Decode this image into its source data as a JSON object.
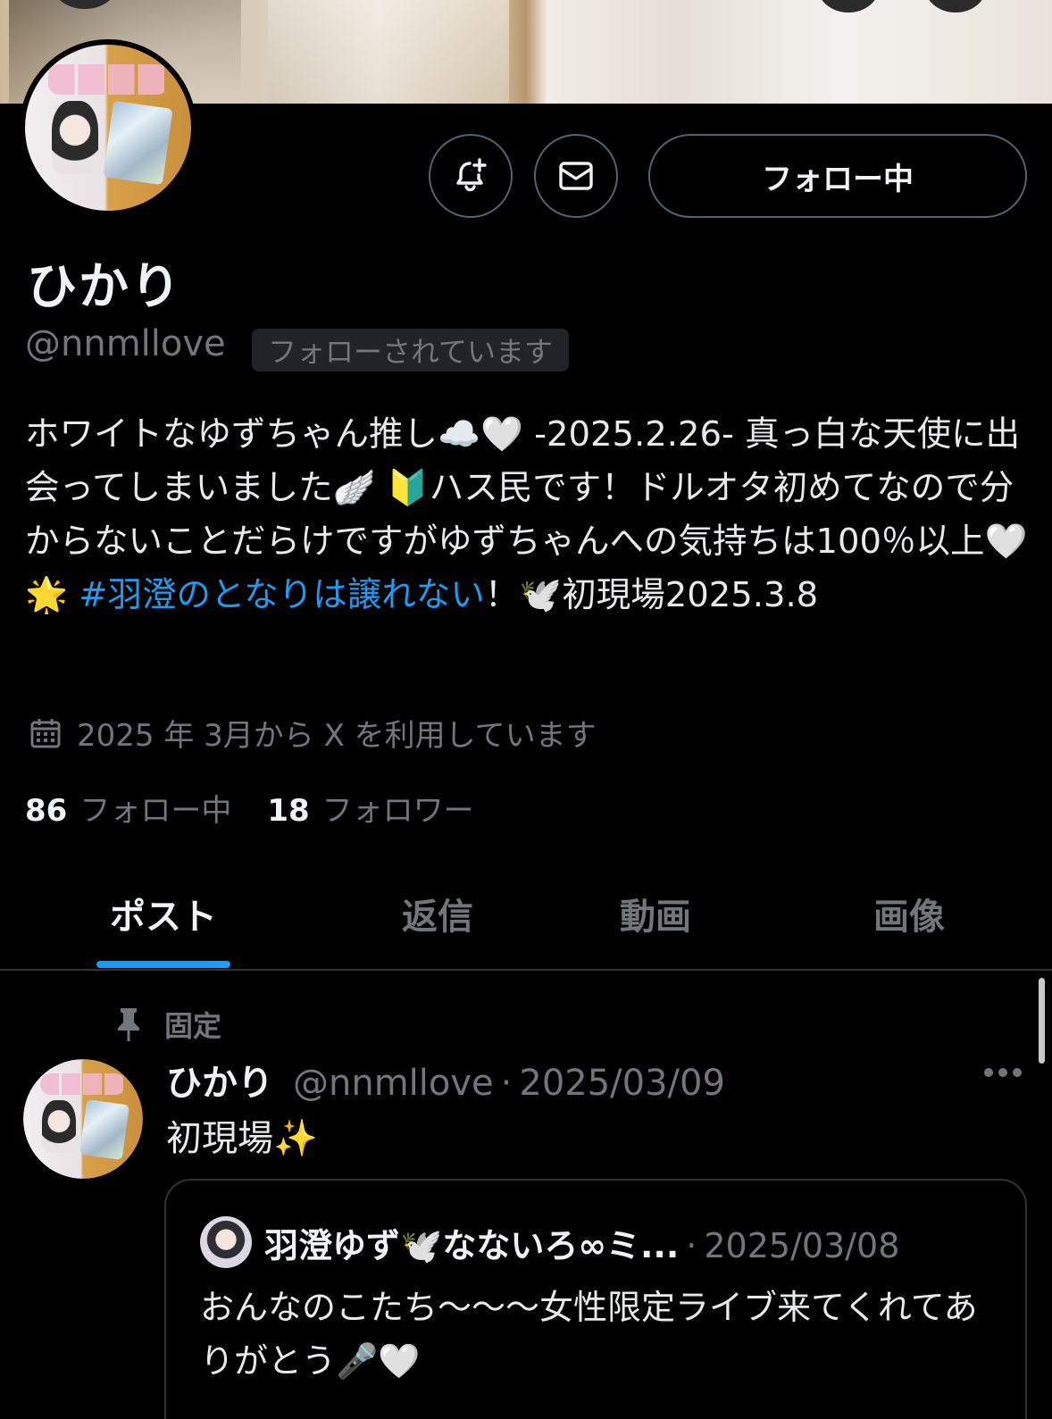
{
  "profile": {
    "name": "ひかり",
    "handle": "@nnmllove",
    "follows_you": "フォローされています",
    "follow_button": "フォロー中",
    "bio_parts": {
      "p1": "ホワイトなゆずちゃん推し☁️🤍 -2025.2.26- 真っ白な天使に出会ってしまいました🪽 🔰ハス民です！ドルオタ初めてなので分からないことだらけですがゆずちゃんへの気持ちは100％以上🤍🌟 ",
      "hashtag": "#羽澄のとなりは譲れない",
      "p2": "！🕊️初現場2025.3.8"
    },
    "joined": "2025 年 3月から X を利用しています",
    "following_count": "86",
    "following_label": "フォロー中",
    "followers_count": "18",
    "followers_label": "フォロワー"
  },
  "tabs": [
    {
      "label": "ポスト",
      "active": true
    },
    {
      "label": "返信",
      "active": false
    },
    {
      "label": "動画",
      "active": false
    },
    {
      "label": "画像",
      "active": false
    }
  ],
  "pinned_post": {
    "pinned_label": "固定",
    "name": "ひかり",
    "handle": "@nnmllove",
    "separator": "·",
    "date": "2025/03/09",
    "text": "初現場✨",
    "quote": {
      "name": "羽澄ゆず🕊️なないろ∞ミ...",
      "separator": "·",
      "date": "2025/03/08",
      "text": "おんなのこたち〜〜〜女性限定ライブ来てくれてありがとう🎤🤍"
    }
  },
  "icons": {
    "notify": "bell-plus-icon",
    "message": "envelope-icon",
    "calendar": "calendar-icon",
    "pin": "pin-icon",
    "more": "more-icon"
  },
  "colors": {
    "accent": "#1d9bf0",
    "background": "#000000",
    "muted": "#71767b"
  }
}
